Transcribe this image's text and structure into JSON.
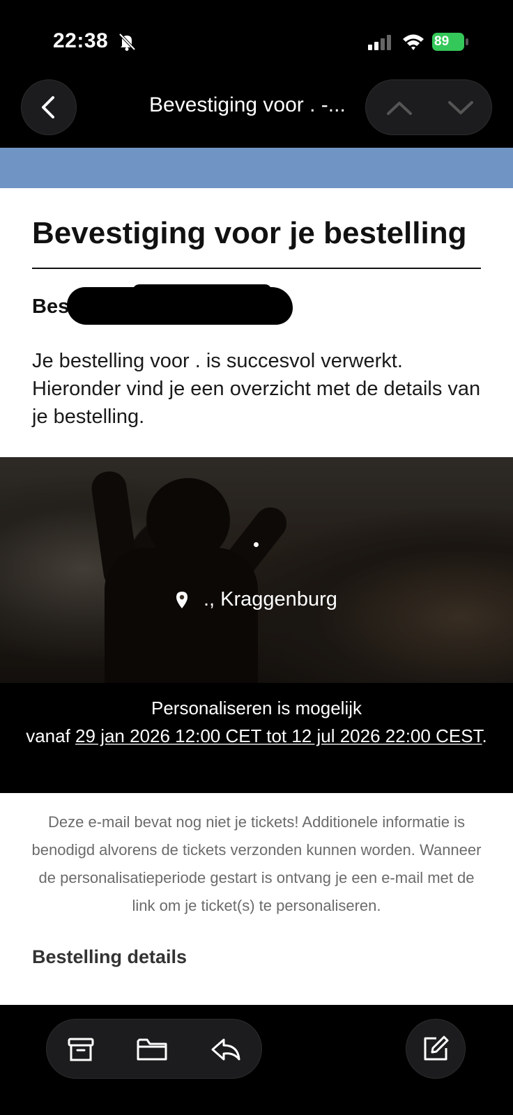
{
  "status_bar": {
    "time": "22:38",
    "battery": "89"
  },
  "nav": {
    "title": "Bevestiging voor . -..."
  },
  "email": {
    "heading": "Bevestiging voor je bestelling",
    "order_label": "Best",
    "intro": "Je bestelling voor . is succesvol verwerkt. Hieronder vind je een overzicht met de details van je bestelling.",
    "location": "., Kraggenburg",
    "personalize_title": "Personaliseren is mogelijk",
    "personalize_prefix": "vanaf",
    "personalize_period": "29 jan 2026 12:00 CET tot 12 jul 2026 22:00 CEST",
    "personalize_suffix": ".",
    "notice": "Deze e-mail bevat nog niet je tickets! Additionele informatie is benodigd alvorens de tickets verzonden kunnen worden. Wanneer de personalisatieperiode gestart is ontvang je een e-mail met de link om je ticket(s) te personaliseren.",
    "details_heading": "Bestelling details"
  },
  "colors": {
    "banner": "#7094c4",
    "battery": "#34c759"
  },
  "icons": [
    "bell-off-icon",
    "signal-icon",
    "wifi-icon",
    "battery-icon",
    "chevron-left-icon",
    "chevron-up-icon",
    "chevron-down-icon",
    "location-pin-icon",
    "archive-icon",
    "folder-icon",
    "reply-icon",
    "compose-icon"
  ]
}
